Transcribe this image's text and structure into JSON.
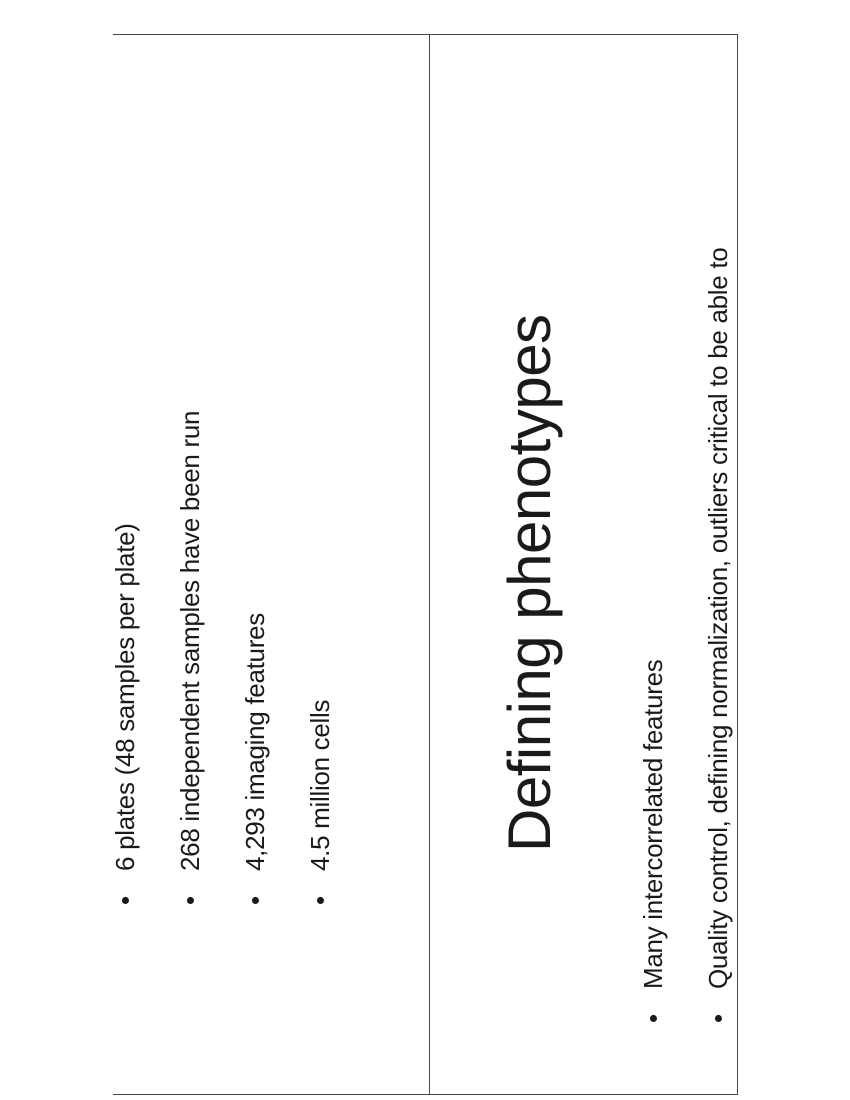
{
  "left_slide": {
    "bullets": [
      "6 plates (48 samples per plate)",
      "268 independent samples have been run",
      "4,293 imaging features",
      "4.5 million cells"
    ]
  },
  "right_slide": {
    "title": "Defining phenotypes",
    "bullets": [
      "Many intercorrelated features",
      "Quality control, defining normalization, outliers critical to be able to"
    ]
  },
  "bullet_symbol": "•"
}
